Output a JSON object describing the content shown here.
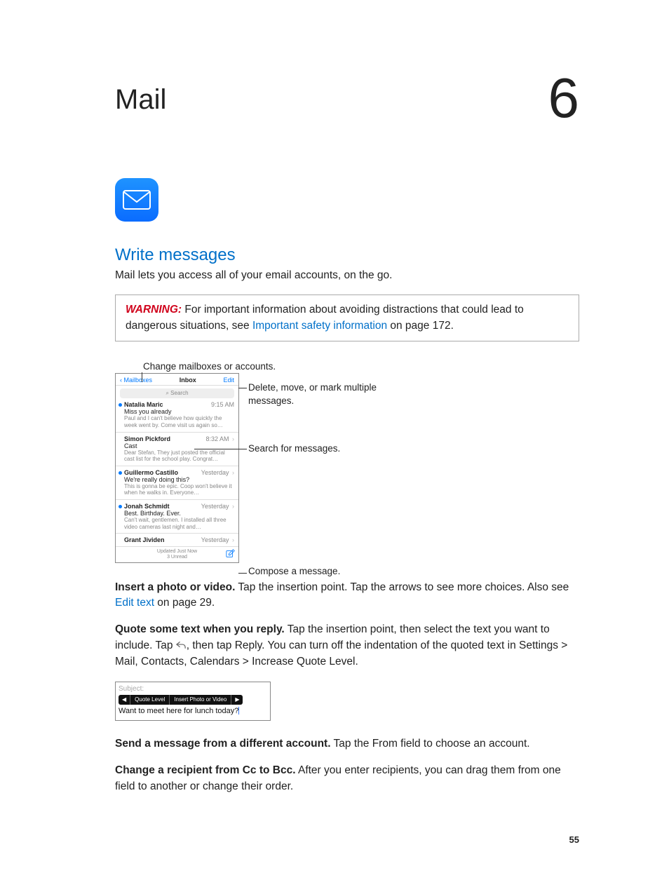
{
  "chapter": {
    "title": "Mail",
    "number": "6"
  },
  "section": {
    "title": "Write messages"
  },
  "intro": "Mail lets you access all of your email accounts, on the go.",
  "warning": {
    "label": "WARNING:",
    "before_link": "For important information about avoiding distractions that could lead to dangerous situations, see ",
    "link": "Important safety information",
    "after_link": " on page 172."
  },
  "callouts": {
    "change_mailboxes": "Change mailboxes or accounts.",
    "edit": "Delete, move, or mark multiple messages.",
    "search": "Search for messages.",
    "compose": "Compose a message."
  },
  "inbox": {
    "back": "Mailboxes",
    "title": "Inbox",
    "edit": "Edit",
    "search_placeholder": "Search",
    "footer_line1": "Updated Just Now",
    "footer_line2": "3 Unread",
    "messages": [
      {
        "unread": true,
        "sender": "Natalia Maric",
        "time": "9:15 AM",
        "chevron": false,
        "subject": "Miss you already",
        "preview": "Paul and I can't believe how quickly the week went by. Come visit us again so…"
      },
      {
        "unread": false,
        "sender": "Simon Pickford",
        "time": "8:32 AM",
        "chevron": true,
        "subject": "Cast",
        "preview": "Dear Stefan, They just posted the official cast list for the school play. Congrat…"
      },
      {
        "unread": true,
        "sender": "Guillermo Castillo",
        "time": "Yesterday",
        "chevron": true,
        "subject": "We're really doing this?",
        "preview": "This is gonna be epic. Coop won't believe it when he walks in. Everyone…"
      },
      {
        "unread": true,
        "sender": "Jonah Schmidt",
        "time": "Yesterday",
        "chevron": true,
        "subject": "Best. Birthday. Ever.",
        "preview": "Can't wait, gentlemen. I installed all three video cameras last night and…"
      },
      {
        "unread": false,
        "sender": "Grant Jividen",
        "time": "Yesterday",
        "chevron": true,
        "subject": "",
        "preview": ""
      }
    ]
  },
  "tips": {
    "insert": {
      "bold": "Insert a photo or video.",
      "before_link": " Tap the insertion point. Tap the arrows to see more choices. Also see ",
      "link": "Edit text",
      "after_link": " on page 29."
    },
    "quote": {
      "bold": "Quote some text when you reply.",
      "text": " Tap the insertion point, then select the text you want to include. Tap ",
      "text2": ", then tap Reply. You can turn off the indentation of the quoted text in Settings > Mail, Contacts, Calendars > Increase Quote Level."
    },
    "diff_account": {
      "bold": "Send a message from a different account.",
      "text": " Tap the From field to choose an account."
    },
    "cc_bcc": {
      "bold": "Change a recipient from Cc to Bcc.",
      "text": " After you enter recipients, you can drag them from one field to another or change their order."
    }
  },
  "menu_fig": {
    "subject_label": "Subject:",
    "left_arrow": "◀",
    "item1": "Quote Level",
    "item2": "Insert Photo or Video",
    "right_arrow": "▶",
    "typed": "Want to meet here for lunch today?"
  },
  "page_number": "55"
}
